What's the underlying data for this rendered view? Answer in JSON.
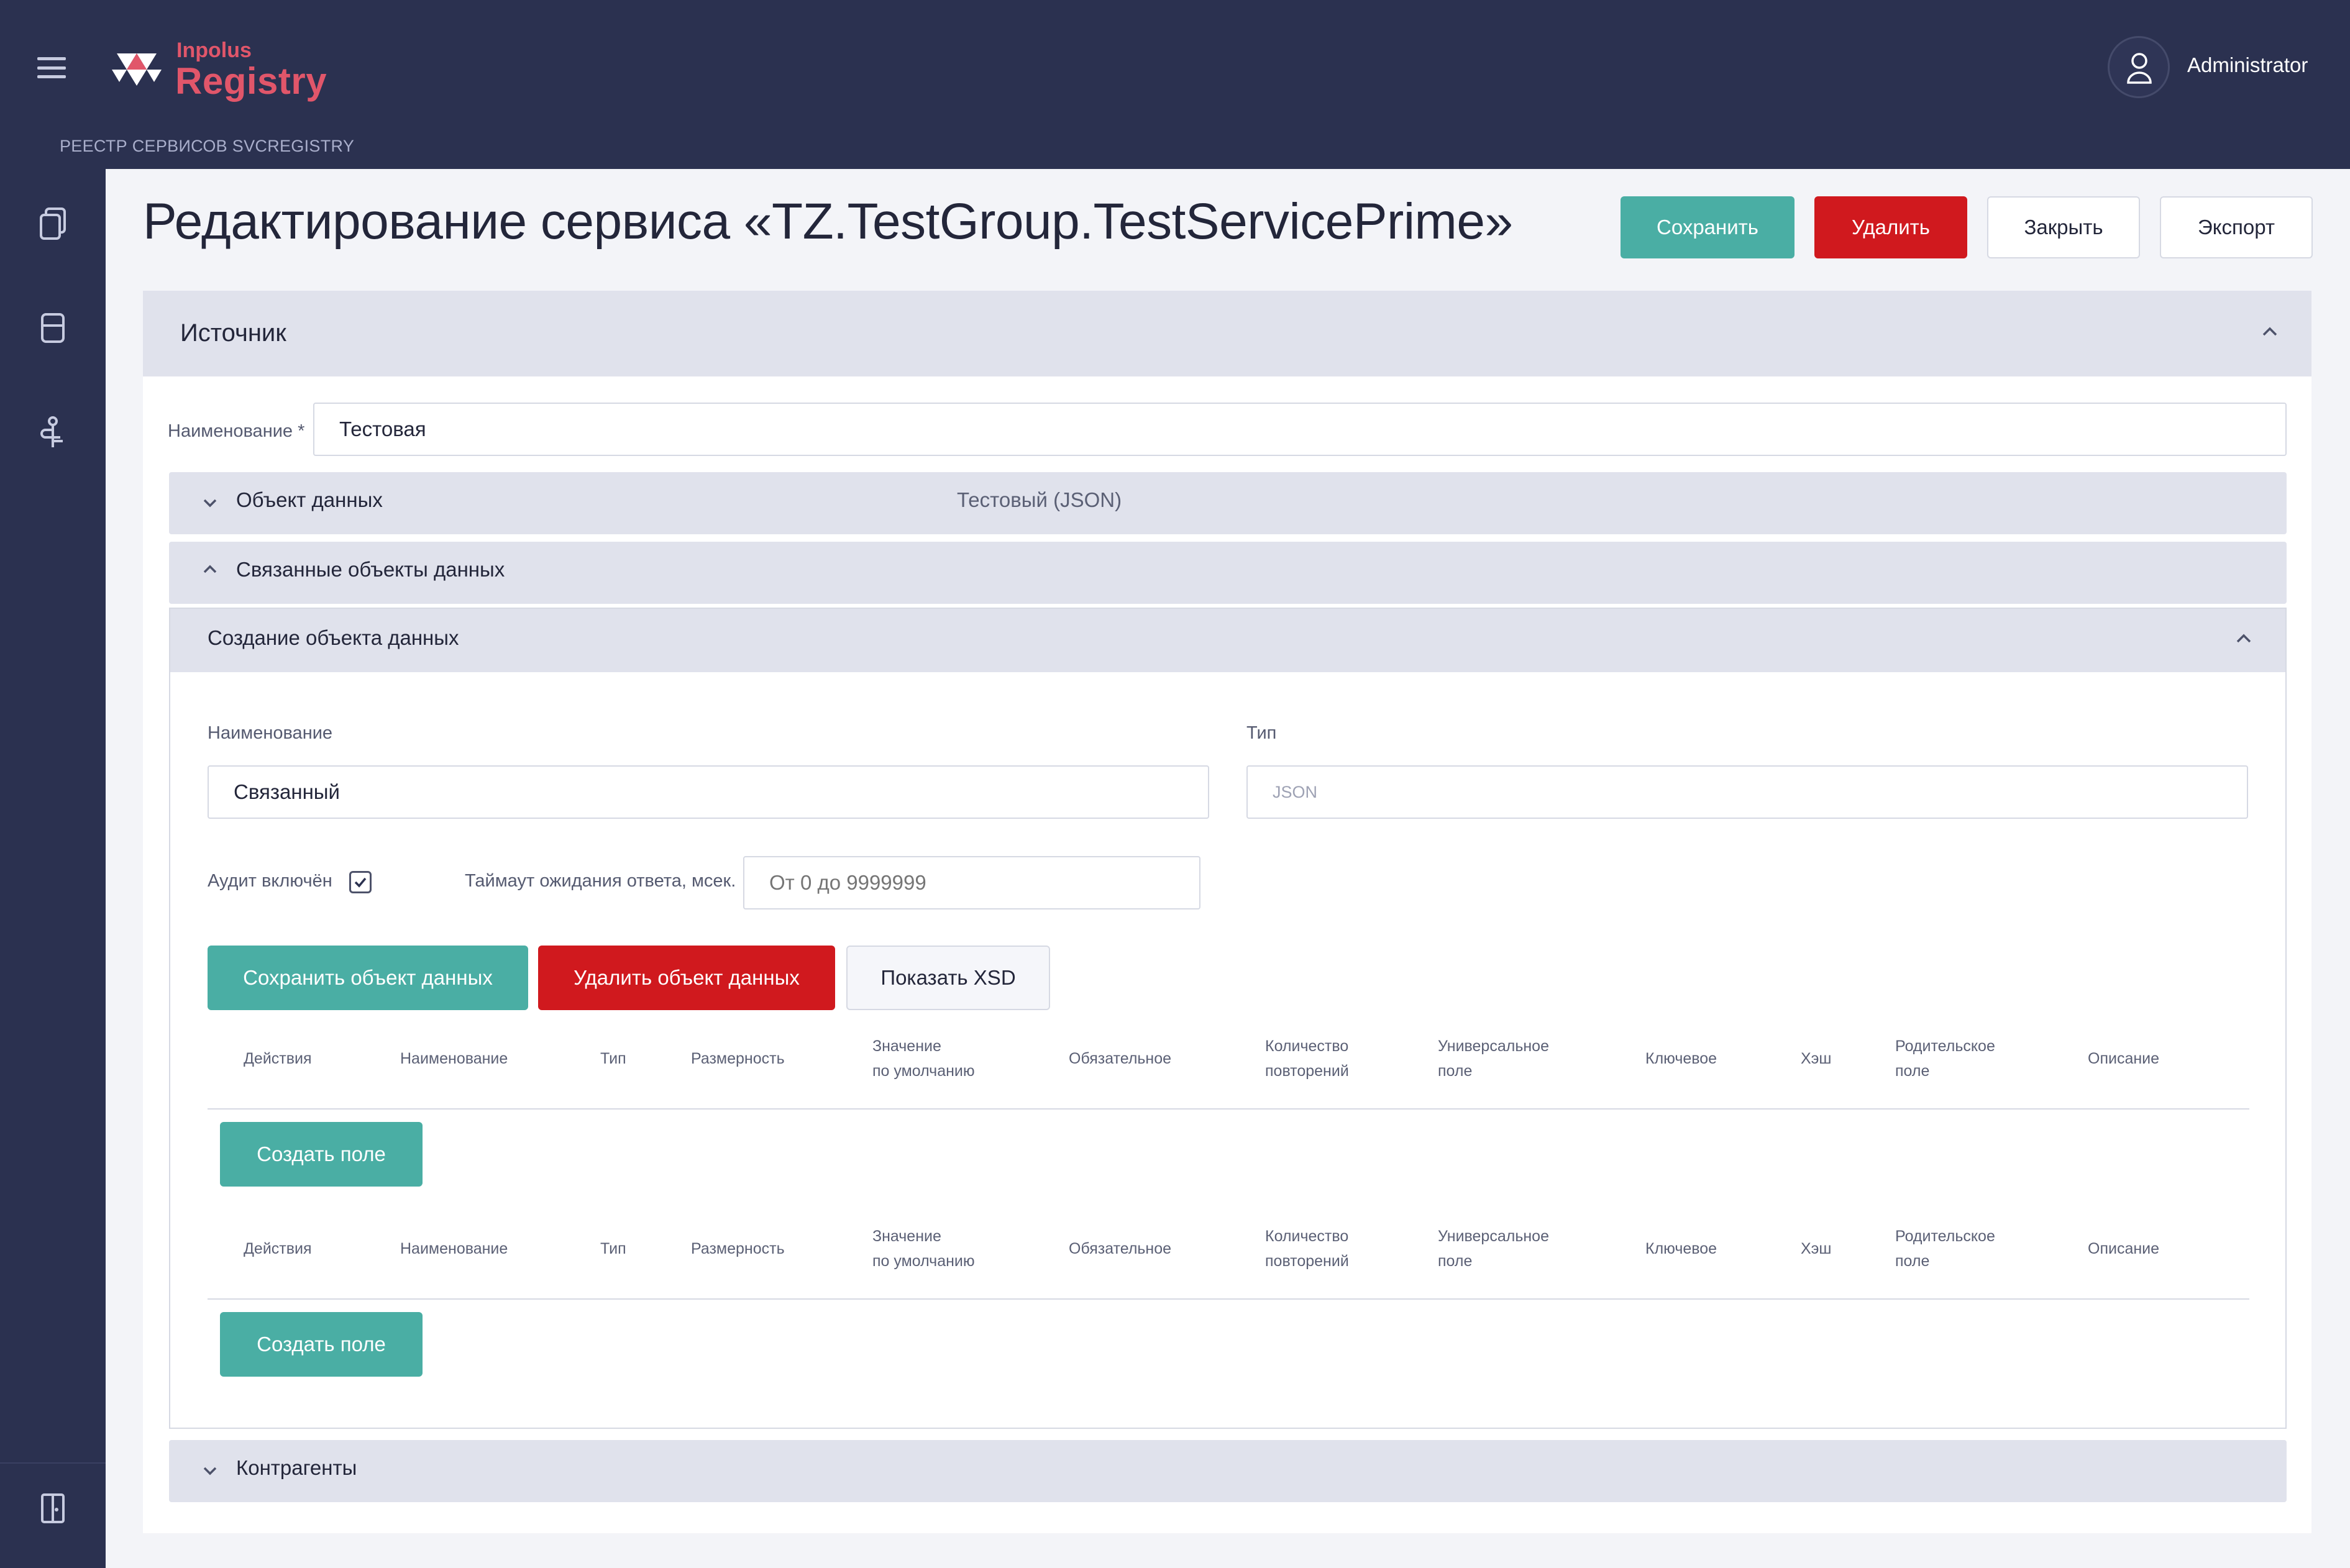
{
  "header": {
    "logo_small": "Inpolus",
    "logo_big": "Registry",
    "breadcrumb": "РЕЕСТР СЕРВИСОВ SVCREGISTRY",
    "username": "Administrator",
    "icons": [
      "menu-icon",
      "user-icon"
    ]
  },
  "sidebar": {
    "icons": [
      "documents-icon",
      "database-icon",
      "network-icon",
      "logout-icon"
    ]
  },
  "page": {
    "title": "Редактирование сервиса «TZ.TestGroup.TestServicePrime»",
    "buttons": {
      "save": "Сохранить",
      "delete": "Удалить",
      "close": "Закрыть",
      "export": "Экспорт"
    }
  },
  "source_section": {
    "title": "Источник",
    "name_label": "Наименование *",
    "name_value": "Тестовая",
    "data_object_label": "Объект данных",
    "data_object_value": "Тестовый (JSON)",
    "related_label": "Связанные объекты данных",
    "counterparties_label": "Контрагенты"
  },
  "create_object": {
    "title": "Создание объекта данных",
    "name_label": "Наименование",
    "name_value": "Связанный",
    "type_label": "Тип",
    "type_value": "JSON",
    "audit_label": "Аудит включён",
    "audit_checked": true,
    "timeout_label": "Таймаут ожидания ответа, мсек.",
    "timeout_placeholder": "От 0 до 9999999",
    "buttons": {
      "save": "Сохранить объект данных",
      "delete": "Удалить объект данных",
      "xsd": "Показать XSD"
    }
  },
  "field_table": {
    "columns": [
      {
        "l1": "Действия",
        "l2": ""
      },
      {
        "l1": "Наименование",
        "l2": ""
      },
      {
        "l1": "Тип",
        "l2": ""
      },
      {
        "l1": "Размерность",
        "l2": ""
      },
      {
        "l1": "Значение",
        "l2": "по умолчанию"
      },
      {
        "l1": "Обязательное",
        "l2": ""
      },
      {
        "l1": "Количество",
        "l2": "повторений"
      },
      {
        "l1": "Универсальное",
        "l2": "поле"
      },
      {
        "l1": "Ключевое",
        "l2": ""
      },
      {
        "l1": "Хэш",
        "l2": ""
      },
      {
        "l1": "Родительское",
        "l2": "поле"
      },
      {
        "l1": "Описание",
        "l2": ""
      }
    ],
    "create_button": "Создать поле"
  },
  "colors": {
    "header_bg": "#2b3150",
    "brand": "#e1566a",
    "teal": "#4aaea4",
    "red": "#d0191e"
  }
}
